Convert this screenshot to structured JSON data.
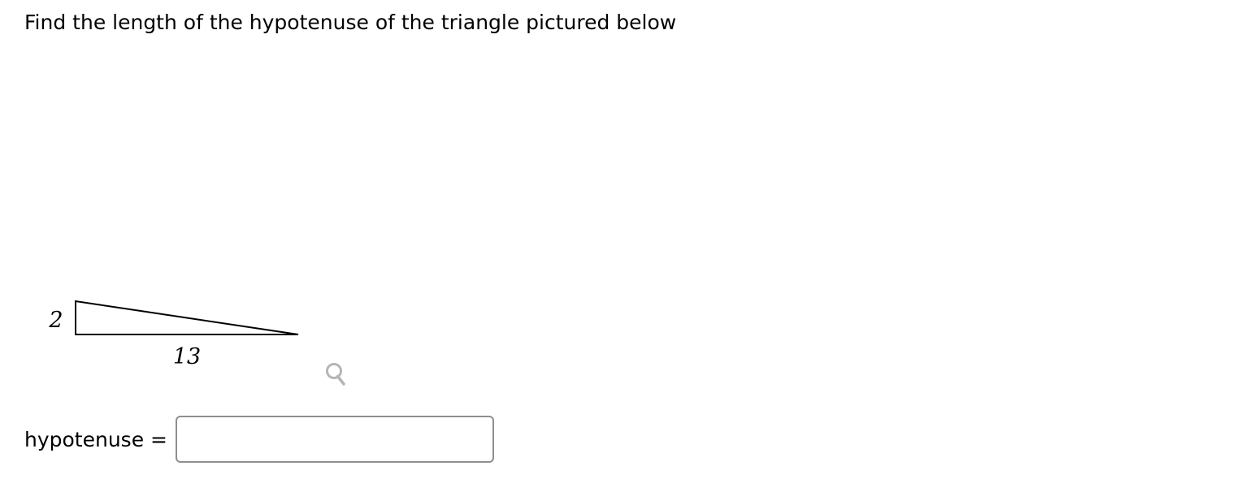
{
  "question": {
    "text": "Find the length of the hypotenuse of the triangle pictured below"
  },
  "figure": {
    "shape": "right-triangle",
    "side_vertical_label": "2",
    "side_horizontal_label": "13",
    "zoom_icon": "magnifier-icon"
  },
  "answer": {
    "label": "hypotenuse =",
    "value": "",
    "placeholder": ""
  },
  "colors": {
    "text": "#000000",
    "input_border": "#8f8f8f",
    "zoom_icon": "#b5b5b5"
  }
}
